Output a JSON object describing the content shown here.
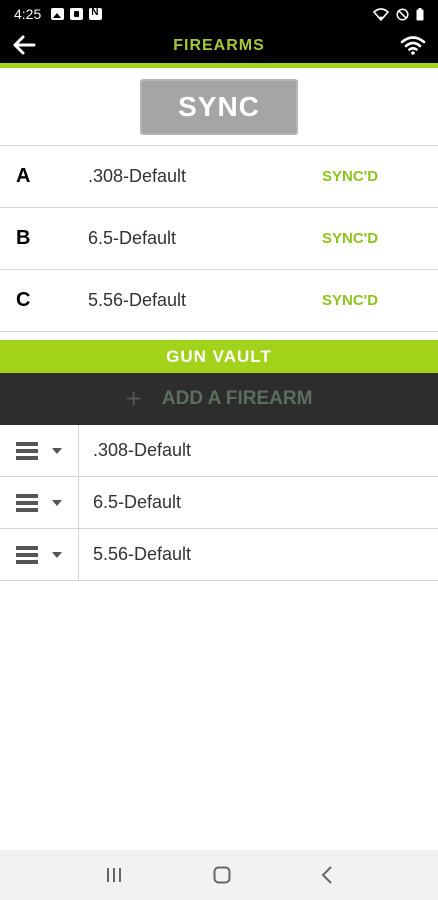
{
  "status_bar": {
    "time": "4:25"
  },
  "app_bar": {
    "title": "FIREARMS"
  },
  "sync_button": {
    "label": "SYNC"
  },
  "slots": [
    {
      "letter": "A",
      "name": ".308-Default",
      "status": "SYNC'D"
    },
    {
      "letter": "B",
      "name": "6.5-Default",
      "status": "SYNC'D"
    },
    {
      "letter": "C",
      "name": "5.56-Default",
      "status": "SYNC'D"
    }
  ],
  "vault": {
    "title": "GUN VAULT",
    "add_label": "ADD A FIREARM",
    "items": [
      {
        "name": ".308-Default"
      },
      {
        "name": "6.5-Default"
      },
      {
        "name": "5.56-Default"
      }
    ]
  },
  "colors": {
    "accent": "#a3d21a",
    "sync_status": "#8cc31f"
  }
}
